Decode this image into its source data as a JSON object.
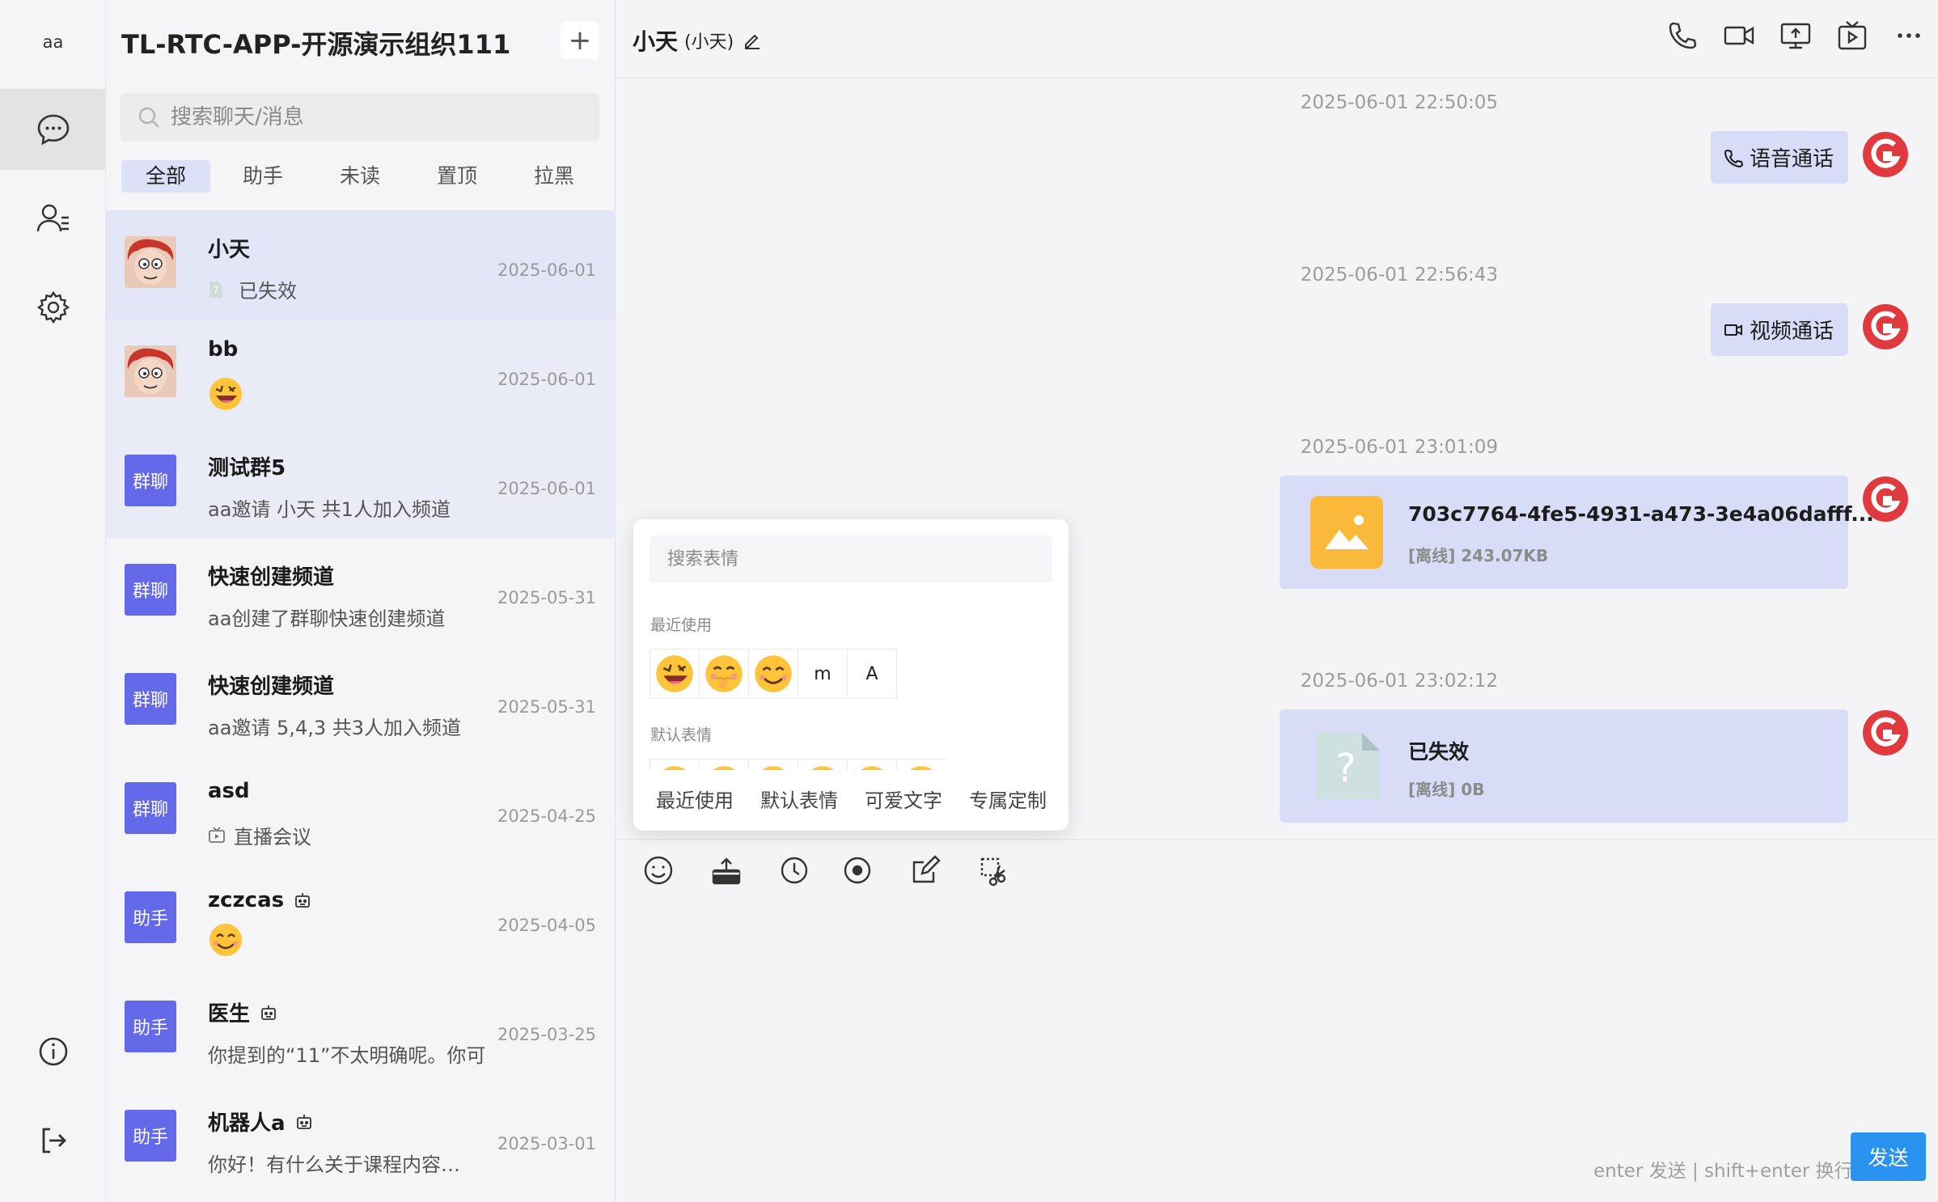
{
  "rail": {
    "user": "aa"
  },
  "list": {
    "org_title": "TL-RTC-APP-开源演示组织111",
    "add_label": "+",
    "search_placeholder": "搜索聊天/消息",
    "tabs": [
      {
        "label": "全部",
        "active": true
      },
      {
        "label": "助手",
        "active": false
      },
      {
        "label": "未读",
        "active": false
      },
      {
        "label": "置顶",
        "active": false
      },
      {
        "label": "拉黑",
        "active": false
      }
    ],
    "items": [
      {
        "name": "小天",
        "preview": "已失效",
        "date": "2025-06-01",
        "avatar": "face"
      },
      {
        "name": "bb",
        "preview": "",
        "date": "2025-06-01",
        "avatar": "face"
      },
      {
        "name": "测试群5",
        "preview": "aa邀请 小天 共1人加入频道",
        "date": "2025-06-01",
        "avatar": "群聊"
      },
      {
        "name": "快速创建频道",
        "preview": "aa创建了群聊快速创建频道",
        "date": "2025-05-31",
        "avatar": "群聊"
      },
      {
        "name": "快速创建频道",
        "preview": "aa邀请 5,4,3 共3人加入频道",
        "date": "2025-05-31",
        "avatar": "群聊"
      },
      {
        "name": "asd",
        "preview": "直播会议",
        "date": "2025-04-25",
        "avatar": "群聊"
      },
      {
        "name": "zczcas",
        "preview": "",
        "date": "2025-04-05",
        "avatar": "助手"
      },
      {
        "name": "医生",
        "preview": "你提到的“11”不太明确呢。你可",
        "date": "2025-03-25",
        "avatar": "助手"
      },
      {
        "name": "机器人a",
        "preview": "你好！有什么关于课程内容…",
        "date": "2025-03-01",
        "avatar": "助手"
      }
    ]
  },
  "chat": {
    "title": "小天",
    "subtitle": "(小天)",
    "messages": [
      {
        "time": "2025-06-01 22:50:05",
        "label": "语音通话"
      },
      {
        "time": "2025-06-01 22:56:43",
        "label": "视频通话"
      },
      {
        "time": "2025-06-01 23:01:09",
        "file_name": "703c7764-4fe5-4931-a473-3e4a06dafff...",
        "file_meta": "[离线] 243.07KB"
      },
      {
        "time": "2025-06-01 23:02:12",
        "file_name": "已失效",
        "file_meta": "[离线] 0B"
      }
    ],
    "hint": "enter 发送 | shift+enter 换行",
    "send_label": "发送"
  },
  "picker": {
    "search_placeholder": "搜索表情",
    "recent_label": "最近使用",
    "default_label": "默认表情",
    "text_emojis": [
      "m",
      "A"
    ],
    "tabs": [
      "最近使用",
      "默认表情",
      "可爱文字",
      "专属定制"
    ]
  },
  "colors": {
    "accent": "#6369e8",
    "bubble": "#d8dcf6",
    "send": "#2a93f0",
    "brand_red": "#e0393e"
  }
}
